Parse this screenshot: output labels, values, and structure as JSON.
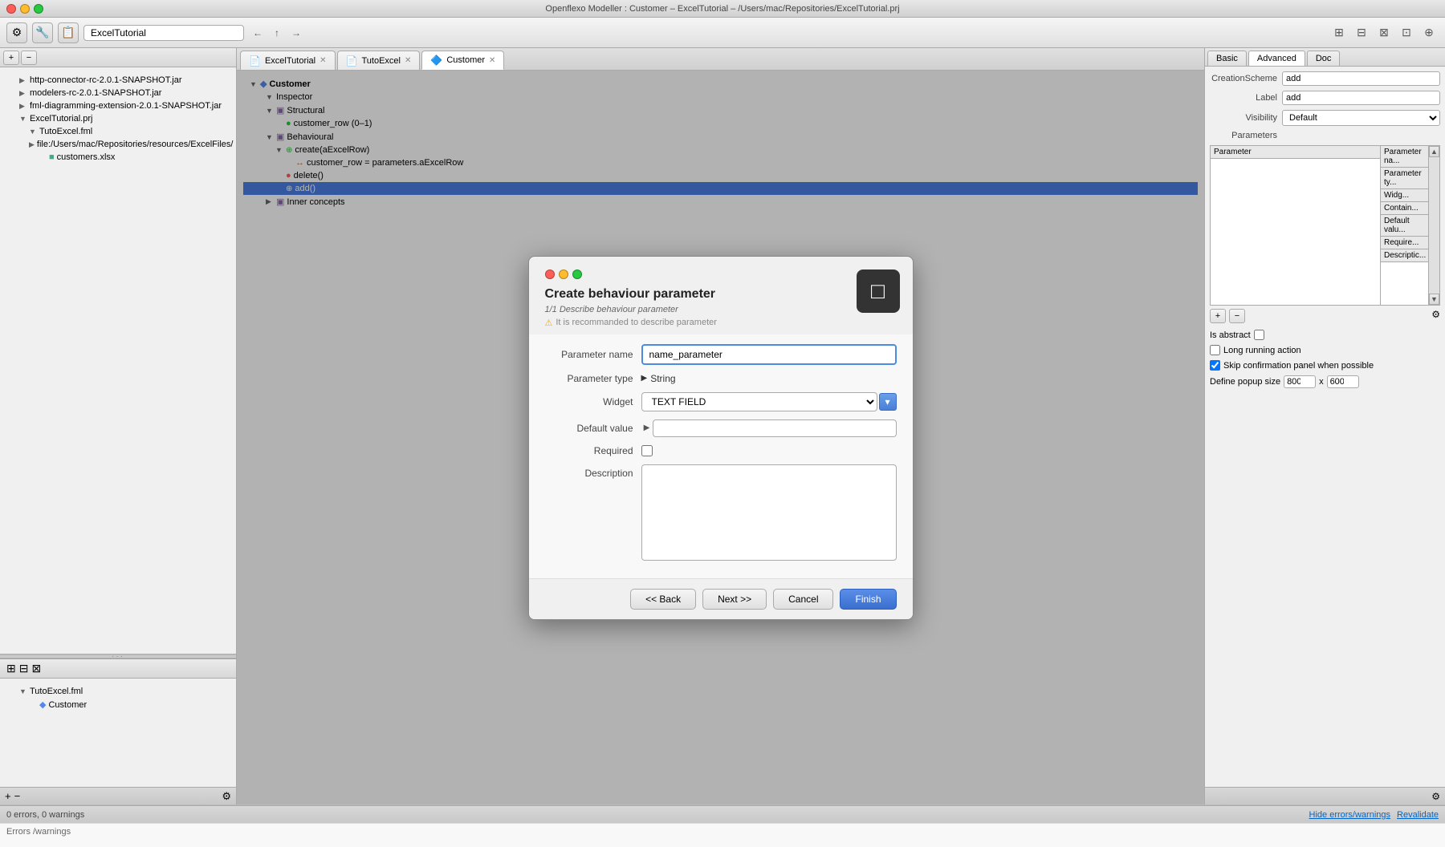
{
  "window": {
    "title": "Openflexo Modeller : Customer – ExcelTutorial – /Users/mac/Repositories/ExcelTutorial.prj"
  },
  "toolbar": {
    "path": "ExcelTutorial",
    "icons": [
      "⚙️",
      "🔧",
      "📋"
    ],
    "nav_back": "←",
    "nav_up": "↑",
    "nav_forward": "→"
  },
  "left_panel": {
    "tree_items": [
      {
        "label": "http-connector-rc-2.0.1-SNAPSHOT.jar",
        "indent": 1,
        "arrow": "▶"
      },
      {
        "label": "modelers-rc-2.0.1-SNAPSHOT.jar",
        "indent": 1,
        "arrow": "▶"
      },
      {
        "label": "fml-diagramming-extension-2.0.1-SNAPSHOT.jar",
        "indent": 1,
        "arrow": "▶"
      },
      {
        "label": "ExcelTutorial.prj",
        "indent": 1,
        "arrow": "▼"
      },
      {
        "label": "TutoExcel.fml",
        "indent": 2,
        "arrow": "▼"
      },
      {
        "label": "file:/Users/mac/Repositories/resources/ExcelFiles/",
        "indent": 2,
        "arrow": "▶"
      },
      {
        "label": "customers.xlsx",
        "indent": 3,
        "arrow": ""
      }
    ],
    "bottom_items": [
      {
        "label": "TutoExcel.fml",
        "indent": 1,
        "arrow": "▼"
      },
      {
        "label": "Customer",
        "indent": 2,
        "arrow": ""
      }
    ]
  },
  "tabs": [
    {
      "label": "ExcelTutorial",
      "active": false,
      "icon": "📄"
    },
    {
      "label": "TutoExcel",
      "active": false,
      "icon": "📄"
    },
    {
      "label": "Customer",
      "active": true,
      "icon": "🔷"
    }
  ],
  "content_tree": {
    "root": "Customer",
    "items": [
      {
        "label": "Inspector",
        "indent": 1,
        "arrow": "▼"
      },
      {
        "label": "Structural",
        "indent": 1,
        "arrow": "▼",
        "folder": true
      },
      {
        "label": "customer_row (0–1)",
        "indent": 2,
        "arrow": "",
        "icon": "🟢"
      },
      {
        "label": "Behavioural",
        "indent": 1,
        "arrow": "▼",
        "folder": true
      },
      {
        "label": "create(aExcelRow)",
        "indent": 2,
        "arrow": "▼",
        "icon": "➕🟢"
      },
      {
        "label": "customer_row = parameters.aExcelRow",
        "indent": 3,
        "arrow": "↔",
        "icon": ""
      },
      {
        "label": "delete()",
        "indent": 2,
        "arrow": "",
        "icon": "🔴"
      },
      {
        "label": "add()",
        "indent": 2,
        "arrow": "",
        "icon": "➕🟢",
        "selected": true
      },
      {
        "label": "Inner concepts",
        "indent": 1,
        "arrow": "▶",
        "folder": true
      }
    ]
  },
  "right_panel": {
    "tabs": [
      "Basic",
      "Advanced",
      "Doc"
    ],
    "active_tab": "Advanced",
    "creation_scheme": "add",
    "label": "add",
    "visibility": "Default",
    "parameters_columns": [
      "Parameter",
      "Parameter name",
      "Parameter type",
      "Widget",
      "Contains",
      "Default value",
      "Required",
      "Description"
    ],
    "is_abstract": false,
    "long_running": false,
    "skip_confirmation": true,
    "popup_width": "800",
    "popup_height": "600"
  },
  "modal": {
    "title": "Create behaviour parameter",
    "step": "1/1  Describe behaviour parameter",
    "warning": "It is recommanded to describe parameter",
    "parameter_name": "name_parameter",
    "parameter_name_label": "Parameter name",
    "parameter_type_label": "Parameter type",
    "parameter_type": "String",
    "widget_label": "Widget",
    "widget_value": "TEXT FIELD",
    "default_value_label": "Default value",
    "required_label": "Required",
    "description_label": "Description",
    "buttons": {
      "back": "<< Back",
      "next": "Next >>",
      "cancel": "Cancel",
      "finish": "Finish"
    }
  },
  "status_bar": {
    "errors": "0 errors, 0 warnings",
    "hide_link": "Hide errors/warnings",
    "revalidate_link": "Revalidate",
    "errors_panel_label": "Errors /warnings"
  }
}
